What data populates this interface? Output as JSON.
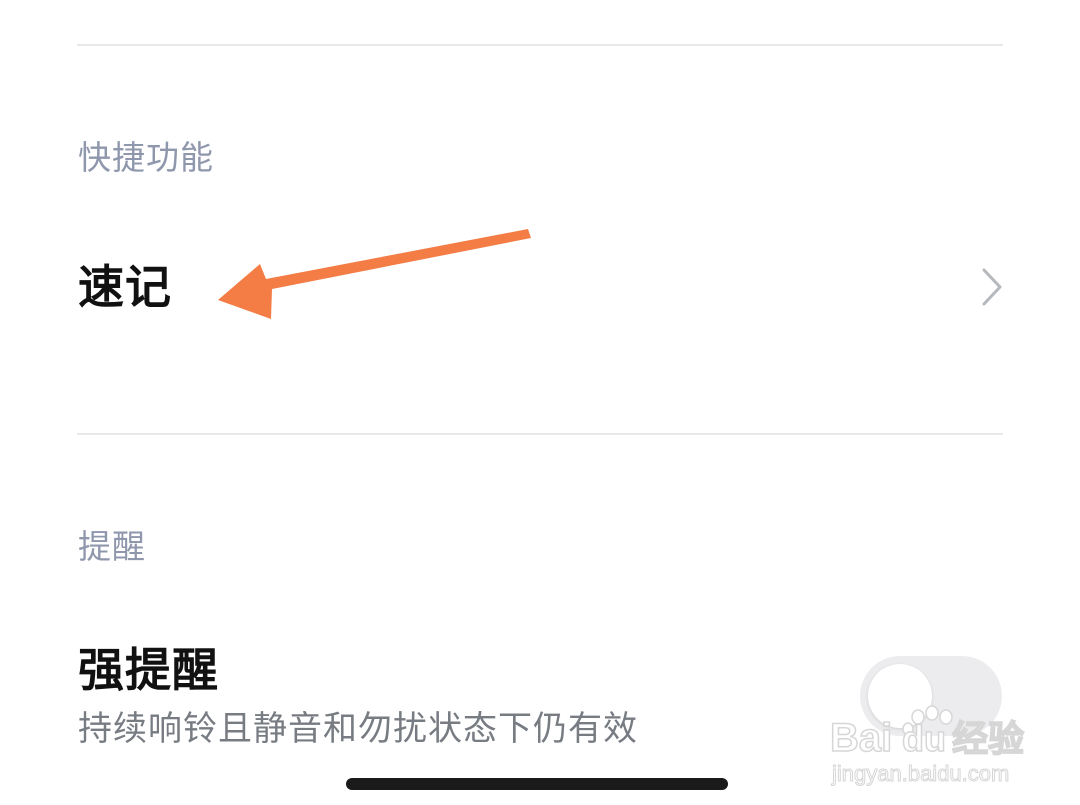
{
  "sections": {
    "shortcuts": {
      "header": "快捷功能",
      "items": [
        {
          "label": "速记"
        }
      ]
    },
    "reminders": {
      "header": "提醒",
      "items": [
        {
          "label": "强提醒",
          "description": "持续响铃且静音和勿扰状态下仍有效",
          "toggle_on": false
        }
      ]
    }
  },
  "annotation": {
    "arrow_color": "#f47c45"
  },
  "watermark": {
    "brand": "Bai",
    "brand_paw_suffix": "du",
    "brand_cn": "经验",
    "url": "jingyan.baidu.com"
  },
  "colors": {
    "header_text": "#8f97ad",
    "title_text": "#111111",
    "subtitle_text": "#777b82",
    "divider": "#e8e8ea"
  }
}
